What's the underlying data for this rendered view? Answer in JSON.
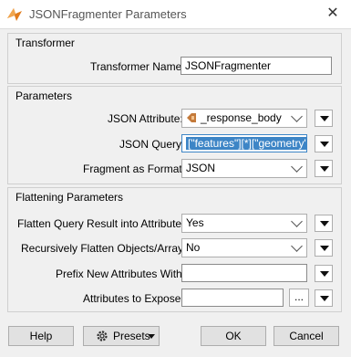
{
  "window": {
    "title": "JSONFragmenter Parameters",
    "close_glyph": "✕"
  },
  "transformer_group": {
    "title": "Transformer",
    "name_label": "Transformer Name:",
    "name_value": "JSONFragmenter"
  },
  "parameters_group": {
    "title": "Parameters",
    "json_attribute_label": "JSON Attribute:",
    "json_attribute_value": "_response_body",
    "json_query_label": "JSON Query:",
    "json_query_value": "[\"features\"][*][\"geometry\"]",
    "fragment_format_label": "Fragment as Format:",
    "fragment_format_value": "JSON"
  },
  "flattening_group": {
    "title": "Flattening Parameters",
    "flatten_label": "Flatten Query Result into Attributes:",
    "flatten_value": "Yes",
    "recursive_label": "Recursively Flatten Objects/Arrays:",
    "recursive_value": "No",
    "prefix_label": "Prefix New Attributes With:",
    "prefix_value": "",
    "expose_label": "Attributes to Expose:",
    "expose_value": "",
    "ellipsis_label": "..."
  },
  "footer": {
    "help_label": "Help",
    "presets_label": "Presets",
    "ok_label": "OK",
    "cancel_label": "Cancel"
  },
  "icons": {
    "app": "fme-app-icon",
    "attribute": "attribute-icon",
    "presets": "gear-icon"
  },
  "colors": {
    "selection": "#3d85c6",
    "attribute_icon": "#c47a3a"
  }
}
